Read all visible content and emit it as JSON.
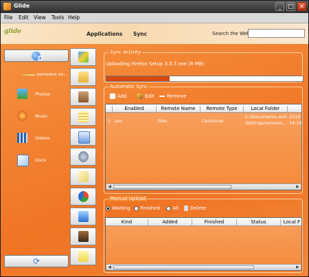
{
  "window": {
    "title": "Glide",
    "minimize": "_",
    "maximize": "□",
    "close": "×"
  },
  "menu": [
    "File",
    "Edit",
    "View",
    "Tools",
    "Help"
  ],
  "topbar": {
    "logo": "glide",
    "applications": "Applications",
    "sync": "Sync",
    "search_label": "Search the Web",
    "search_value": ""
  },
  "left_nav": {
    "user": "someone so...",
    "items": [
      {
        "label": "Photos"
      },
      {
        "label": "Music"
      },
      {
        "label": "Videos"
      },
      {
        "label": "Docs"
      }
    ]
  },
  "icon_column": [
    "applications-icon",
    "folder-icon",
    "address-book-icon",
    "notepad-icon",
    "document-icon",
    "settings-icon",
    "note-icon",
    "chart-icon",
    "upload-icon",
    "photo-icon",
    "sticky-note-icon"
  ],
  "sync_activity": {
    "legend": "Sync Activity",
    "status": "Uploading Firefox Setup 3.5.7.exe (8 MB)",
    "progress": 0.32
  },
  "automatic_sync": {
    "legend": "Automatic Sync",
    "add": "Add",
    "edit": "Edit",
    "remove": "Remove",
    "columns": [
      "Enabled",
      "Remote Name",
      "Remote Type",
      "Local Folder"
    ],
    "rows": [
      {
        "num": "1",
        "enabled": "yes",
        "remote_name": "files",
        "remote_type": "Container",
        "local_folder_1": "C:/Documents and",
        "local_folder_2": "Settings/someon...",
        "date": "2010",
        "time": "14:18"
      }
    ]
  },
  "manual_upload": {
    "legend": "Manual Upload",
    "waiting": "Waiting",
    "finished": "Finished",
    "all": "All",
    "delete": "Delete",
    "columns": [
      "Kind",
      "Added",
      "Finished",
      "Status",
      "Local F"
    ]
  },
  "colors": {
    "accent": "#f07c2c",
    "progress": "#d34a10"
  }
}
